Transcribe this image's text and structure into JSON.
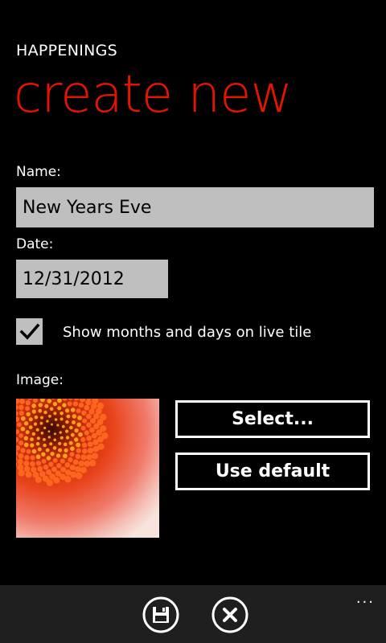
{
  "app": {
    "title": "HAPPENINGS",
    "page_title": "create new"
  },
  "form": {
    "name_label": "Name:",
    "name_value": "New Years Eve",
    "date_label": "Date:",
    "date_value": "12/31/2012",
    "show_tile_checked": true,
    "show_tile_label": "Show months and days on live tile",
    "image_label": "Image:",
    "select_button": "Select...",
    "default_button": "Use default"
  },
  "appbar": {
    "save_icon": "save-icon",
    "cancel_icon": "close-icon",
    "more_label": "..."
  },
  "colors": {
    "accent": "#e51400",
    "background": "#000000",
    "textbox": "#bfbfbf",
    "appbar": "#1f1f1f"
  }
}
